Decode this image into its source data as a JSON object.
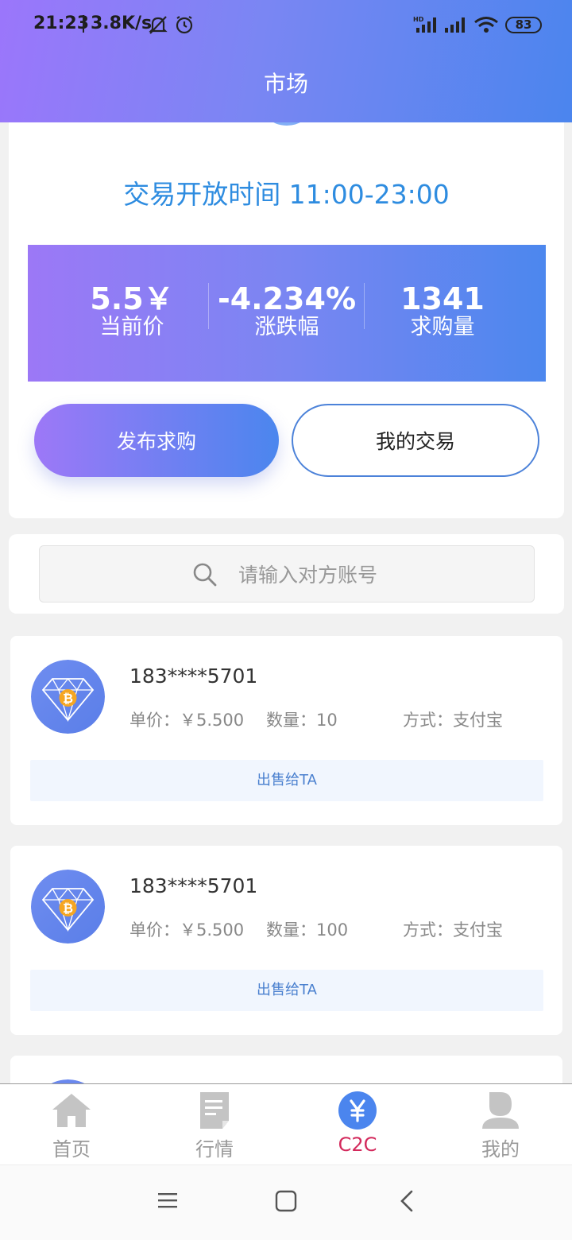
{
  "status_bar": {
    "time": "21:23",
    "network_speed": "3.8K/s",
    "battery": "83",
    "icons": [
      "bell-off-icon",
      "alarm-icon",
      "hd-signal-icon",
      "signal-icon",
      "wifi-icon",
      "battery-icon"
    ]
  },
  "header": {
    "title": "市场"
  },
  "market": {
    "open_time": "交易开放时间 11:00-23:00",
    "stats": [
      {
        "value": "5.5￥",
        "label": "当前价"
      },
      {
        "value": "-4.234%",
        "label": "涨跌幅"
      },
      {
        "value": "1341",
        "label": "求购量"
      }
    ],
    "publish_button": "发布求购",
    "my_trade_button": "我的交易"
  },
  "search": {
    "placeholder": "请输入对方账号",
    "value": ""
  },
  "listings": [
    {
      "account": "183****5701",
      "price": "单价：￥5.500",
      "quantity": "数量：10",
      "method": "方式：支付宝",
      "action": "出售给TA"
    },
    {
      "account": "183****5701",
      "price": "单价：￥5.500",
      "quantity": "数量：100",
      "method": "方式：支付宝",
      "action": "出售给TA"
    }
  ],
  "bottom_nav": {
    "items": [
      {
        "label": "首页",
        "icon": "home-icon"
      },
      {
        "label": "行情",
        "icon": "document-icon"
      },
      {
        "label": "C2C",
        "icon": "yuan-icon",
        "active": true
      },
      {
        "label": "我的",
        "icon": "person-icon"
      }
    ],
    "active_color": "#d3295c",
    "inactive_color": "#999999"
  },
  "colors": {
    "accent_blue": "#4b85ee",
    "accent_purple": "#9b76fb",
    "open_time_text": "#2e8ce0"
  }
}
